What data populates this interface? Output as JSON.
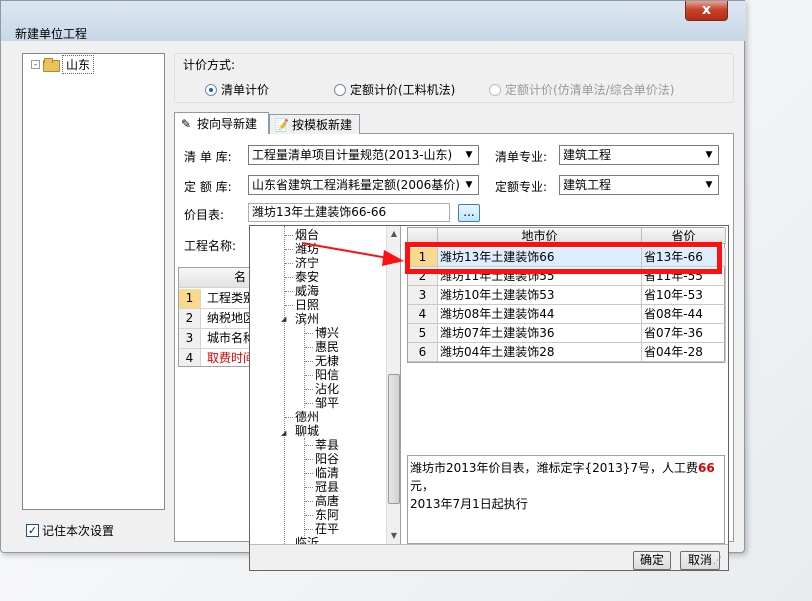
{
  "window": {
    "title": "新建单位工程",
    "close": "x"
  },
  "tree": {
    "root": "山东"
  },
  "remember": {
    "label": "记住本次设置",
    "checked": true
  },
  "pricing": {
    "group_label": "计价方式:",
    "options": [
      "清单计价",
      "定额计价(工料机法)",
      "定额计价(仿清单法/综合单价法)"
    ]
  },
  "tabs": [
    "按向导新建",
    "按模板新建"
  ],
  "form": {
    "list_lib_label": "清  单  库:",
    "list_lib_value": "工程量清单项目计量规范(2013-山东)",
    "list_major_label": "清单专业:",
    "list_major_value": "建筑工程",
    "quota_lib_label": "定  额  库:",
    "quota_lib_value": "山东省建筑工程消耗量定额(2006基价)",
    "quota_major_label": "定额专业:",
    "quota_major_value": "建筑工程",
    "price_table_label": "价目表:",
    "price_table_value": "潍坊13年土建装饰66-66",
    "browse": "...",
    "project_name_label": "工程名称:"
  },
  "left_table": {
    "header": "名",
    "rows": [
      {
        "num": "1",
        "text": "工程类别",
        "red": false
      },
      {
        "num": "2",
        "text": "纳税地区",
        "red": false
      },
      {
        "num": "3",
        "text": "城市名称",
        "red": false
      },
      {
        "num": "4",
        "text": "取费时间",
        "red": true
      }
    ]
  },
  "popup": {
    "cities": [
      "烟台",
      "潍坊",
      "济宁",
      "泰安",
      "威海",
      "日照",
      "滨州",
      "德州",
      "聊城",
      "临沂"
    ],
    "binzhou_children": [
      "博兴",
      "惠民",
      "无棣",
      "阳信",
      "沾化",
      "邹平"
    ],
    "liaocheng_children": [
      "莘县",
      "阳谷",
      "临清",
      "冠县",
      "高唐",
      "东阿",
      "茌平"
    ],
    "grid_headers": [
      "地市价",
      "省价"
    ],
    "rows": [
      {
        "num": "1",
        "city": "潍坊13年土建装饰66",
        "prov": "省13年-66"
      },
      {
        "num": "2",
        "city": "潍坊11年土建装饰55",
        "prov": "省11年-55"
      },
      {
        "num": "3",
        "city": "潍坊10年土建装饰53",
        "prov": "省10年-53"
      },
      {
        "num": "4",
        "city": "潍坊08年土建装饰44",
        "prov": "省08年-44"
      },
      {
        "num": "5",
        "city": "潍坊07年土建装饰36",
        "prov": "省07年-36"
      },
      {
        "num": "6",
        "city": "潍坊04年土建装饰28",
        "prov": "省04年-28"
      }
    ],
    "desc_a": "潍坊市2013年价目表，潍标定字{2013}7号，人工费",
    "desc_b": "66",
    "desc_c": "元，",
    "desc_d": "2013年7月1日起执行",
    "ok": "确定",
    "cancel": "取消"
  },
  "colors": {
    "highlight": "#ff1010",
    "red_text": "#e00000"
  }
}
